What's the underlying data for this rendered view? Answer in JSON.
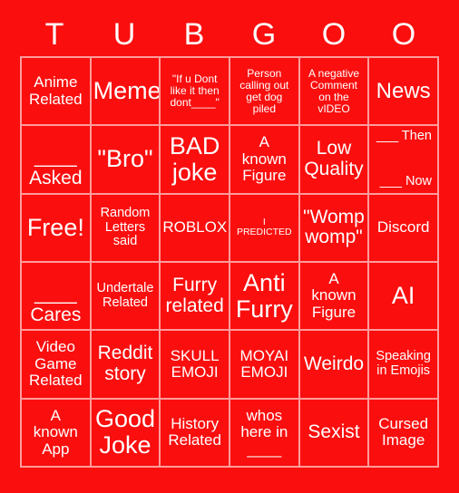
{
  "card": {
    "background_color": "#FA0E0E",
    "border_color": "#FF9C9C",
    "text_color": "#FFFFFF",
    "header_letters": [
      "T",
      "U",
      "B",
      "G",
      "O",
      "O"
    ],
    "columns": 6,
    "rows": 6,
    "cells": [
      [
        {
          "text": "Anime\nRelated",
          "size": "md"
        },
        {
          "text": "Meme",
          "size": "xxl"
        },
        {
          "text": "\"If u Dont\nlike it then\ndont____\"",
          "size": "xs"
        },
        {
          "text": "Person\ncalling out\nget dog\npiled",
          "size": "xs"
        },
        {
          "text": "A negative\nComment\non the\nvIDEO",
          "size": "xs"
        },
        {
          "text": "News",
          "size": "xl"
        }
      ],
      [
        {
          "text": "____\nAsked",
          "size": "lg",
          "style": "bottom"
        },
        {
          "text": "\"Bro\"",
          "size": "xxl"
        },
        {
          "text": "BAD\njoke",
          "size": "xxl"
        },
        {
          "text": "A\nknown\nFigure",
          "size": "md"
        },
        {
          "text": "Low\nQuality",
          "size": "lg"
        },
        {
          "text": "___ Then\n___ Now",
          "size": "sm",
          "style": "spread"
        }
      ],
      [
        {
          "text": "Free!",
          "size": "xxl"
        },
        {
          "text": "Random\nLetters\nsaid",
          "size": "sm"
        },
        {
          "text": "ROBLOX",
          "size": "md"
        },
        {
          "text": "I\nPREDICTED",
          "size": "xxs"
        },
        {
          "text": "\"Womp\nwomp\"",
          "size": "lg"
        },
        {
          "text": "Discord",
          "size": "md"
        }
      ],
      [
        {
          "text": "____\nCares",
          "size": "lg",
          "style": "bottom"
        },
        {
          "text": "Undertale\nRelated",
          "size": "sm"
        },
        {
          "text": "Furry\nrelated",
          "size": "lg"
        },
        {
          "text": "Anti\nFurry",
          "size": "xxl"
        },
        {
          "text": "A\nknown\nFigure",
          "size": "md"
        },
        {
          "text": "AI",
          "size": "xxl"
        }
      ],
      [
        {
          "text": "Video\nGame\nRelated",
          "size": "md"
        },
        {
          "text": "Reddit\nstory",
          "size": "lg"
        },
        {
          "text": "SKULL\nEMOJI",
          "size": "md"
        },
        {
          "text": "MOYAI\nEMOJI",
          "size": "md"
        },
        {
          "text": "Weirdo",
          "size": "lg"
        },
        {
          "text": "Speaking\nin Emojis",
          "size": "sm"
        }
      ],
      [
        {
          "text": "A\nknown\nApp",
          "size": "md"
        },
        {
          "text": "Good\nJoke",
          "size": "xxl"
        },
        {
          "text": "History\nRelated",
          "size": "md"
        },
        {
          "text": "whos\nhere in\n____",
          "size": "md"
        },
        {
          "text": "Sexist",
          "size": "lg"
        },
        {
          "text": "Cursed\nImage",
          "size": "md"
        }
      ]
    ]
  }
}
